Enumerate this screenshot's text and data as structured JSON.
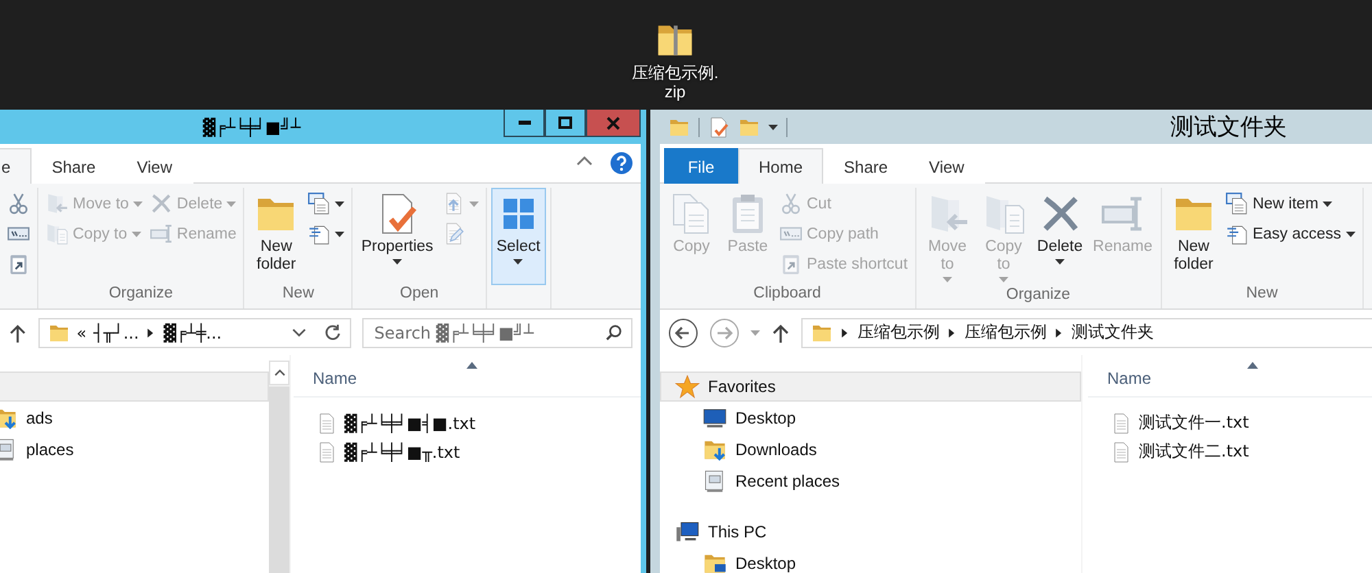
{
  "desktop": {
    "icon": {
      "label": "压缩包示例.zip"
    }
  },
  "windows": [
    {
      "active": true,
      "title": "▓╒┴╘╪╛■╝┴",
      "controls": true,
      "help": true,
      "tabs": [
        {
          "label": "e",
          "selected": true
        },
        {
          "label": "Share",
          "selected": false
        },
        {
          "label": "View",
          "selected": false
        }
      ],
      "ribbon": [
        {
          "items": [
            {
              "kind": "stack",
              "items": [
                {
                  "disabled": false
                },
                {
                  "disabled": false
                },
                {
                  "disabled": false
                }
              ]
            }
          ]
        },
        {
          "label": "Organize",
          "items": [
            {
              "kind": "stack",
              "items": [
                {
                  "label": "Move to",
                  "disabled": true,
                  "dropdown": true
                },
                {
                  "label": "Copy to",
                  "disabled": true,
                  "dropdown": true
                }
              ]
            },
            {
              "kind": "stack",
              "items": [
                {
                  "label": "Delete",
                  "disabled": true,
                  "dropdown": true
                },
                {
                  "label": "Rename",
                  "disabled": true
                }
              ]
            }
          ]
        },
        {
          "label": "New",
          "items": [
            {
              "kind": "large",
              "label": "New folder",
              "disabled": false
            },
            {
              "kind": "stack",
              "items": [
                {
                  "disabled": false,
                  "dropdown": true
                },
                {
                  "disabled": false,
                  "dropdown": true
                }
              ]
            }
          ]
        },
        {
          "label": "Open",
          "items": [
            {
              "kind": "large",
              "label": "Properties",
              "disabled": false,
              "dropdown": true
            },
            {
              "kind": "stack",
              "items": [
                {
                  "disabled": true,
                  "dropdown": true
                },
                {
                  "disabled": true
                }
              ]
            }
          ]
        },
        {
          "items": [
            {
              "kind": "large",
              "label": "Select",
              "disabled": false,
              "dropdown": true,
              "highlighted": true
            }
          ]
        }
      ],
      "address": {
        "overflow": "«",
        "crumbs": [
          "┤╥┘...",
          "▓╒┴╪..."
        ]
      },
      "search": {
        "placeholder": "Search ▓╒┴╘╪╛■╝┴"
      },
      "nav": [
        {
          "selected": true,
          "children": [
            {
              "label": "ads",
              "selected": false
            },
            {
              "label": "places",
              "selected": false
            }
          ]
        }
      ],
      "list": {
        "column": "Name",
        "files": [
          "▓╒┴╘╪╛■╡■.txt",
          "▓╒┴╘╪╛■╥.txt"
        ]
      }
    },
    {
      "active": false,
      "title": "测试文件夹",
      "quick_access": true,
      "tabs": [
        {
          "label": "File",
          "kind": "file",
          "selected": false
        },
        {
          "label": "Home",
          "selected": true
        },
        {
          "label": "Share",
          "selected": false
        },
        {
          "label": "View",
          "selected": false
        }
      ],
      "ribbon": [
        {
          "label": "Clipboard",
          "items": [
            {
              "kind": "large",
              "label": "Copy",
              "disabled": true
            },
            {
              "kind": "large",
              "label": "Paste",
              "disabled": true
            },
            {
              "kind": "stack",
              "items": [
                {
                  "label": "Cut",
                  "disabled": true
                },
                {
                  "label": "Copy path",
                  "disabled": true
                },
                {
                  "label": "Paste shortcut",
                  "disabled": true
                }
              ]
            }
          ]
        },
        {
          "label": "Organize",
          "items": [
            {
              "kind": "large",
              "label": "Move to",
              "disabled": true,
              "dropdown": true
            },
            {
              "kind": "large",
              "label": "Copy to",
              "disabled": true,
              "dropdown": true
            },
            {
              "kind": "large",
              "label": "Delete",
              "disabled": false,
              "dropdown": true
            },
            {
              "kind": "large",
              "label": "Rename",
              "disabled": true
            }
          ]
        },
        {
          "label": "New",
          "items": [
            {
              "kind": "large",
              "label": "New folder",
              "disabled": false
            },
            {
              "kind": "stack",
              "items": [
                {
                  "label": "New item",
                  "disabled": false,
                  "dropdown": true
                },
                {
                  "label": "Easy access",
                  "disabled": false,
                  "dropdown": true
                }
              ]
            }
          ]
        }
      ],
      "history": {
        "back_disabled": false,
        "forward_disabled": true
      },
      "address": {
        "crumbs": [
          "压缩包示例",
          "压缩包示例",
          "测试文件夹"
        ]
      },
      "nav": [
        {
          "label": "Favorites",
          "selected": true,
          "children": [
            {
              "label": "Desktop",
              "selected": false
            },
            {
              "label": "Downloads",
              "selected": false
            },
            {
              "label": "Recent places",
              "selected": false
            }
          ]
        },
        {
          "label": "This PC",
          "selected": false,
          "children": [
            {
              "label": "Desktop",
              "selected": false
            }
          ]
        }
      ],
      "list": {
        "column": "Name",
        "files": [
          "测试文件一.txt",
          "测试文件二.txt"
        ]
      }
    }
  ]
}
